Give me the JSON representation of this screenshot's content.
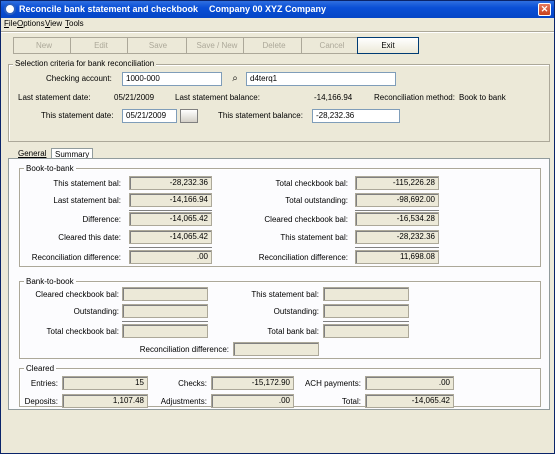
{
  "window": {
    "title": "Reconcile bank statement and checkbook",
    "company": "Company 00  XYZ Company",
    "close_glyph": "✕"
  },
  "menu": [
    "File",
    "Options",
    "View",
    "Tools"
  ],
  "toolbar": {
    "new": "New",
    "edit": "Edit",
    "save": "Save",
    "save_new": "Save / New",
    "delete": "Delete",
    "cancel": "Cancel",
    "exit": "Exit"
  },
  "criteria": {
    "group_label": "Selection criteria for bank reconciliation",
    "checking_account_label": "Checking account:",
    "checking_account_value": "1000-000",
    "account_desc": "d4terq1",
    "last_statement_date_label": "Last statement date:",
    "last_statement_date_value": "05/21/2009",
    "last_statement_balance_label": "Last statement balance:",
    "last_statement_balance_value": "-14,166.94",
    "reconciliation_method_label": "Reconciliation method:",
    "reconciliation_method_value": "Book to bank",
    "this_statement_date_label": "This statement date:",
    "this_statement_date_value": "05/21/2009",
    "this_statement_balance_label": "This statement balance:",
    "this_statement_balance_value": "-28,232.36"
  },
  "tabs": {
    "general": "General",
    "summary": "Summary"
  },
  "book_to_bank": {
    "label": "Book-to-bank",
    "this_statement_bal_label": "This statement bal:",
    "this_statement_bal": "-28,232.36",
    "last_statement_bal_label": "Last statement bal:",
    "last_statement_bal": "-14,166.94",
    "difference_label": "Difference:",
    "difference": "-14,065.42",
    "cleared_this_date_label": "Cleared this date:",
    "cleared_this_date": "-14,065.42",
    "reconciliation_difference_label": "Reconciliation difference:",
    "reconciliation_difference": ".00",
    "total_checkbook_bal_label": "Total checkbook bal:",
    "total_checkbook_bal": "-115,226.28",
    "total_outstanding_label": "Total outstanding:",
    "total_outstanding": "-98,692.00",
    "cleared_checkbook_bal_label": "Cleared checkbook bal:",
    "cleared_checkbook_bal": "-16,534.28",
    "this_statement_bal2_label": "This statement bal:",
    "this_statement_bal2": "-28,232.36",
    "reconciliation_difference2_label": "Reconciliation difference:",
    "reconciliation_difference2": "11,698.08"
  },
  "bank_to_book": {
    "label": "Bank-to-book",
    "cleared_checkbook_bal_label": "Cleared checkbook bal:",
    "outstanding_label": "Outstanding:",
    "total_checkbook_bal_label": "Total checkbook bal:",
    "this_statement_bal_label": "This statement bal:",
    "outstanding2_label": "Outstanding:",
    "total_bank_bal_label": "Total bank bal:",
    "reconciliation_difference_label": "Reconciliation difference:"
  },
  "cleared": {
    "label": "Cleared",
    "entries_label": "Entries:",
    "entries": "15",
    "checks_label": "Checks:",
    "checks": "-15,172.90",
    "ach_label": "ACH payments:",
    "ach": ".00",
    "deposits_label": "Deposits:",
    "deposits": "1,107.48",
    "adjustments_label": "Adjustments:",
    "adjustments": ".00",
    "total_label": "Total:",
    "total": "-14,065.42"
  }
}
